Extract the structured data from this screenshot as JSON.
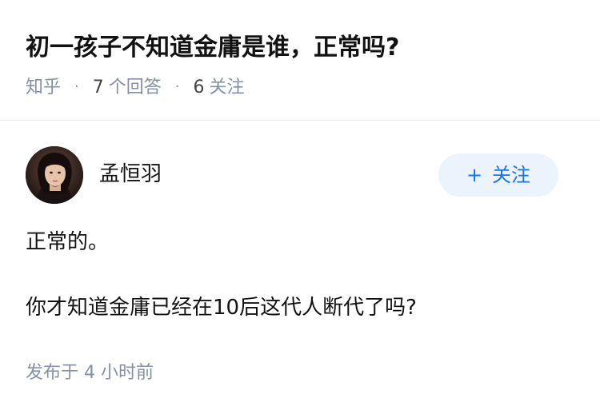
{
  "question": {
    "title": "初一孩子不知道金庸是谁，正常吗?",
    "source": "知乎",
    "separator": "·",
    "answer_count": "7",
    "answer_label": "个回答",
    "follower_count": "6",
    "follower_label": "关注"
  },
  "answer": {
    "author_name": "孟恒羽",
    "follow_button": {
      "plus": "+",
      "label": "关注"
    },
    "paragraphs": [
      "正常的。",
      "你才知道金庸已经在10后这代人断代了吗?"
    ],
    "publish_prefix": "发布于",
    "publish_time": "4 小时前"
  },
  "colors": {
    "accent": "#1772f6",
    "follow_button_bg": "#ebf4fd",
    "meta_text": "#8590a6",
    "primary_text": "#121212",
    "divider": "#ebebeb"
  }
}
